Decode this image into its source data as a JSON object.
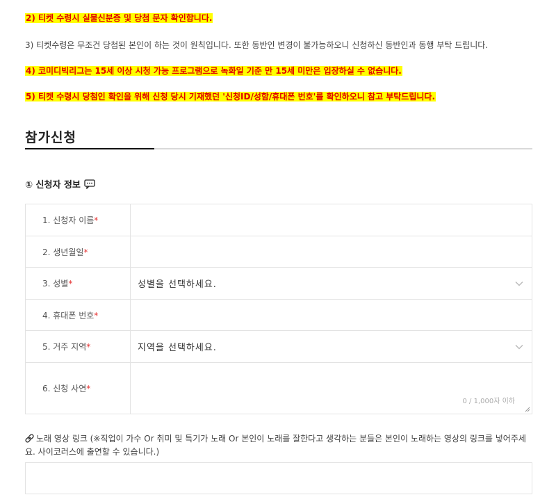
{
  "notices": {
    "n2": "2) 티켓 수령시 실물신분증 및 당첨 문자 확인합니다.",
    "n3": "3) 티켓수령은 무조건 당첨된 본인이 하는 것이 원칙입니다. 또한 동반인 변경이 불가능하오니 신청하신 동반인과 동행 부탁 드립니다.",
    "n4": "4) 코미디빅리그는 15세 이상 시청 가능 프로그램으로 녹화일 기준 만 15세 미만은 입장하실 수 없습니다.",
    "n5": "5) 티켓 수령시 당첨인 확인을 위해 신청 당시 기재했던 '신청ID/성함/휴대폰 번호'를 확인하오니 참고 부탁드립니다."
  },
  "section": {
    "title": "참가신청"
  },
  "applicant": {
    "subtitle": "① 신청자 정보",
    "required_mark": "*",
    "fields": [
      {
        "label": "1. 신청자 이름",
        "value": ""
      },
      {
        "label": "2. 생년월일",
        "value": ""
      },
      {
        "label": "3. 성별",
        "value": "성별을 선택하세요."
      },
      {
        "label": "4. 휴대폰 번호",
        "value": ""
      },
      {
        "label": "5. 거주 지역",
        "value": "지역을 선택하세요."
      },
      {
        "label": "6. 신청 사연",
        "value": "",
        "counter": "0 / 1,000자 이하"
      }
    ]
  },
  "song_link": {
    "label": "노래 영상 링크 (※직업이 가수 Or 취미 및 특기가 노래 Or 본인이 노래를 잘한다고 생각하는 분들은 본인이 노래하는 영상의 링크를 넣어주세요. 사이코러스에 출연할 수 있습니다.)",
    "value": ""
  },
  "colors": {
    "highlight": "#ffff00",
    "warning_text": "#e00000",
    "required": "#e53030"
  },
  "icons": {
    "subtitle_icon": "chat-bubble-icon",
    "dropdown_icon": "chevron-down-icon",
    "link_icon": "link-icon"
  }
}
